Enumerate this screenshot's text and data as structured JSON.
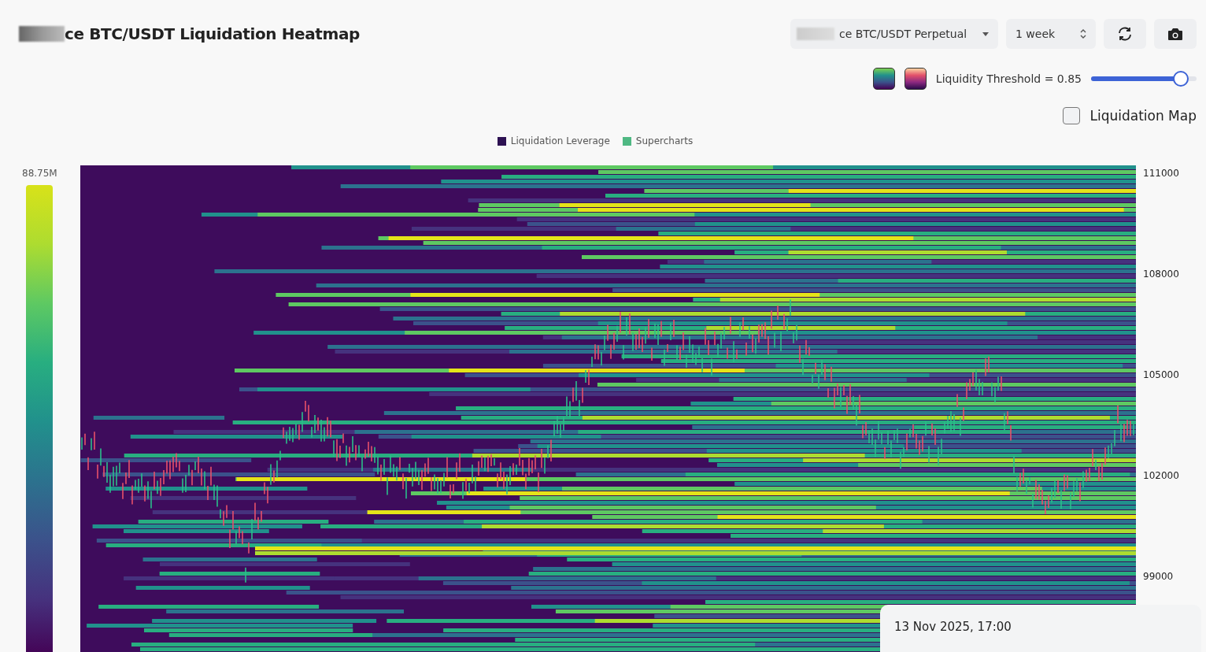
{
  "title": "ce BTC/USDT Liquidation Heatmap",
  "symbol_select": {
    "value": "ce BTC/USDT Perpetual"
  },
  "range_select": {
    "value": "1 week"
  },
  "threshold": {
    "label": "Liquidity Threshold = 0.85",
    "level": 0.85
  },
  "liquidation_map": {
    "label": "Liquidation Map",
    "checked": false
  },
  "legend": [
    {
      "label": "Liquidation Leverage",
      "color": "#2d1152"
    },
    {
      "label": "Supercharts",
      "color": "#4fb883"
    }
  ],
  "color_scale": {
    "max_label": "88.75M"
  },
  "y_axis": [
    "111000",
    "108000",
    "105000",
    "102000",
    "99000"
  ],
  "tooltip": {
    "date": "13 Nov 2025, 17:00"
  }
}
